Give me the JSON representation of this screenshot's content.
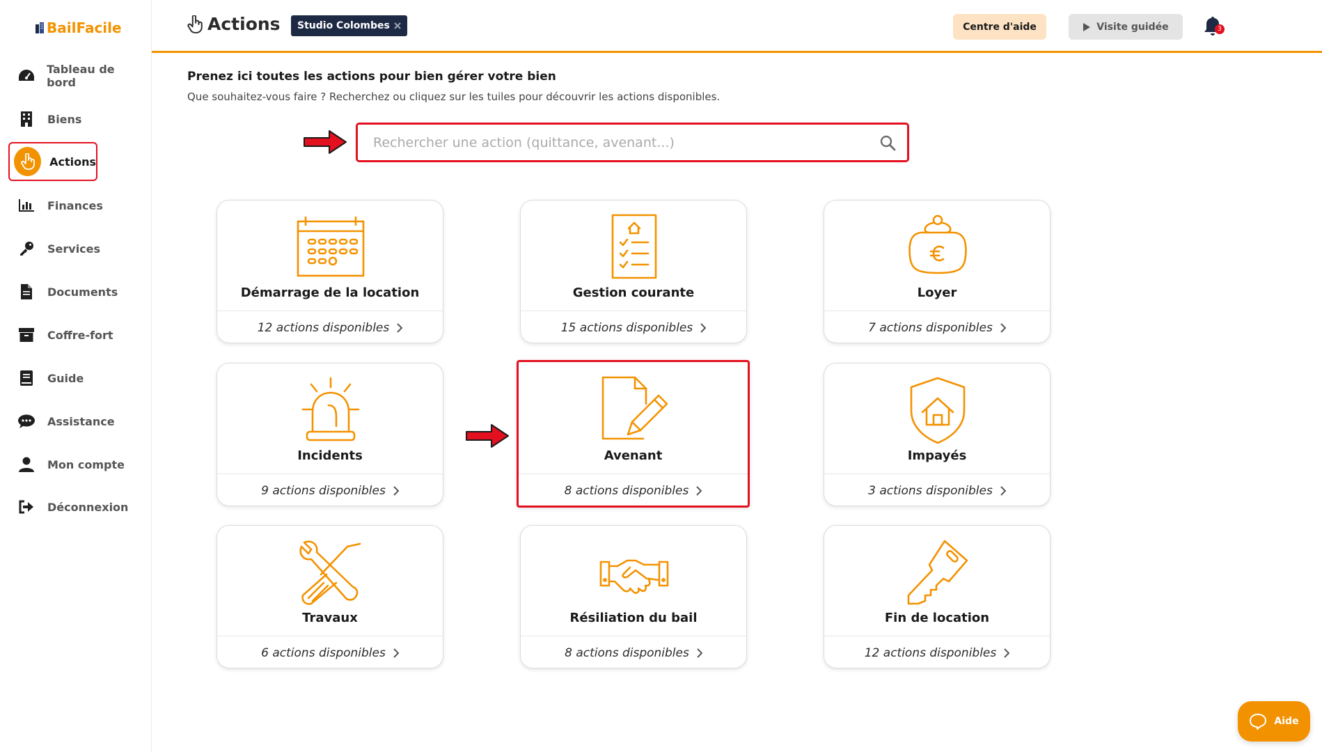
{
  "app": {
    "logo": "BailFacile"
  },
  "sidebar": {
    "items": [
      {
        "label": "Tableau de bord",
        "icon": "dashboard-icon"
      },
      {
        "label": "Biens",
        "icon": "building-icon"
      },
      {
        "label": "Actions",
        "icon": "hand-pointer-icon",
        "active": true
      },
      {
        "label": "Finances",
        "icon": "bar-chart-icon"
      },
      {
        "label": "Services",
        "icon": "key-icon"
      },
      {
        "label": "Documents",
        "icon": "document-icon"
      },
      {
        "label": "Coffre-fort",
        "icon": "archive-icon"
      },
      {
        "label": "Guide",
        "icon": "book-icon"
      },
      {
        "label": "Assistance",
        "icon": "chat-icon"
      },
      {
        "label": "Mon compte",
        "icon": "user-icon"
      },
      {
        "label": "Déconnexion",
        "icon": "logout-icon"
      }
    ]
  },
  "header": {
    "title": "Actions",
    "property_badge": "Studio Colombes",
    "help_button": "Centre d'aide",
    "tour_button": "Visite guidée",
    "notification_count": "3"
  },
  "main": {
    "intro_title": "Prenez ici toutes les actions pour bien gérer votre bien",
    "intro_sub": "Que souhaitez-vous faire ? Recherchez ou cliquez sur les tuiles pour découvrir les actions disponibles.",
    "search_placeholder": "Rechercher une action (quittance, avenant...)",
    "tiles": [
      {
        "title": "Démarrage de la location",
        "count": "12 actions disponibles",
        "icon": "calendar-icon"
      },
      {
        "title": "Gestion courante",
        "count": "15 actions disponibles",
        "icon": "checklist-icon"
      },
      {
        "title": "Loyer",
        "count": "7 actions disponibles",
        "icon": "purse-euro-icon"
      },
      {
        "title": "Incidents",
        "count": "9 actions disponibles",
        "icon": "alarm-light-icon"
      },
      {
        "title": "Avenant",
        "count": "8 actions disponibles",
        "icon": "document-pencil-icon",
        "highlighted": true
      },
      {
        "title": "Impayés",
        "count": "3 actions disponibles",
        "icon": "shield-house-icon"
      },
      {
        "title": "Travaux",
        "count": "6 actions disponibles",
        "icon": "tools-icon"
      },
      {
        "title": "Résiliation du bail",
        "count": "8 actions disponibles",
        "icon": "handshake-icon"
      },
      {
        "title": "Fin de location",
        "count": "12 actions disponibles",
        "icon": "key-icon"
      }
    ]
  },
  "floating": {
    "aide_label": "Aide"
  },
  "colors": {
    "accent": "#f39200",
    "highlight": "#e3101f",
    "badge": "#1e2a44"
  }
}
